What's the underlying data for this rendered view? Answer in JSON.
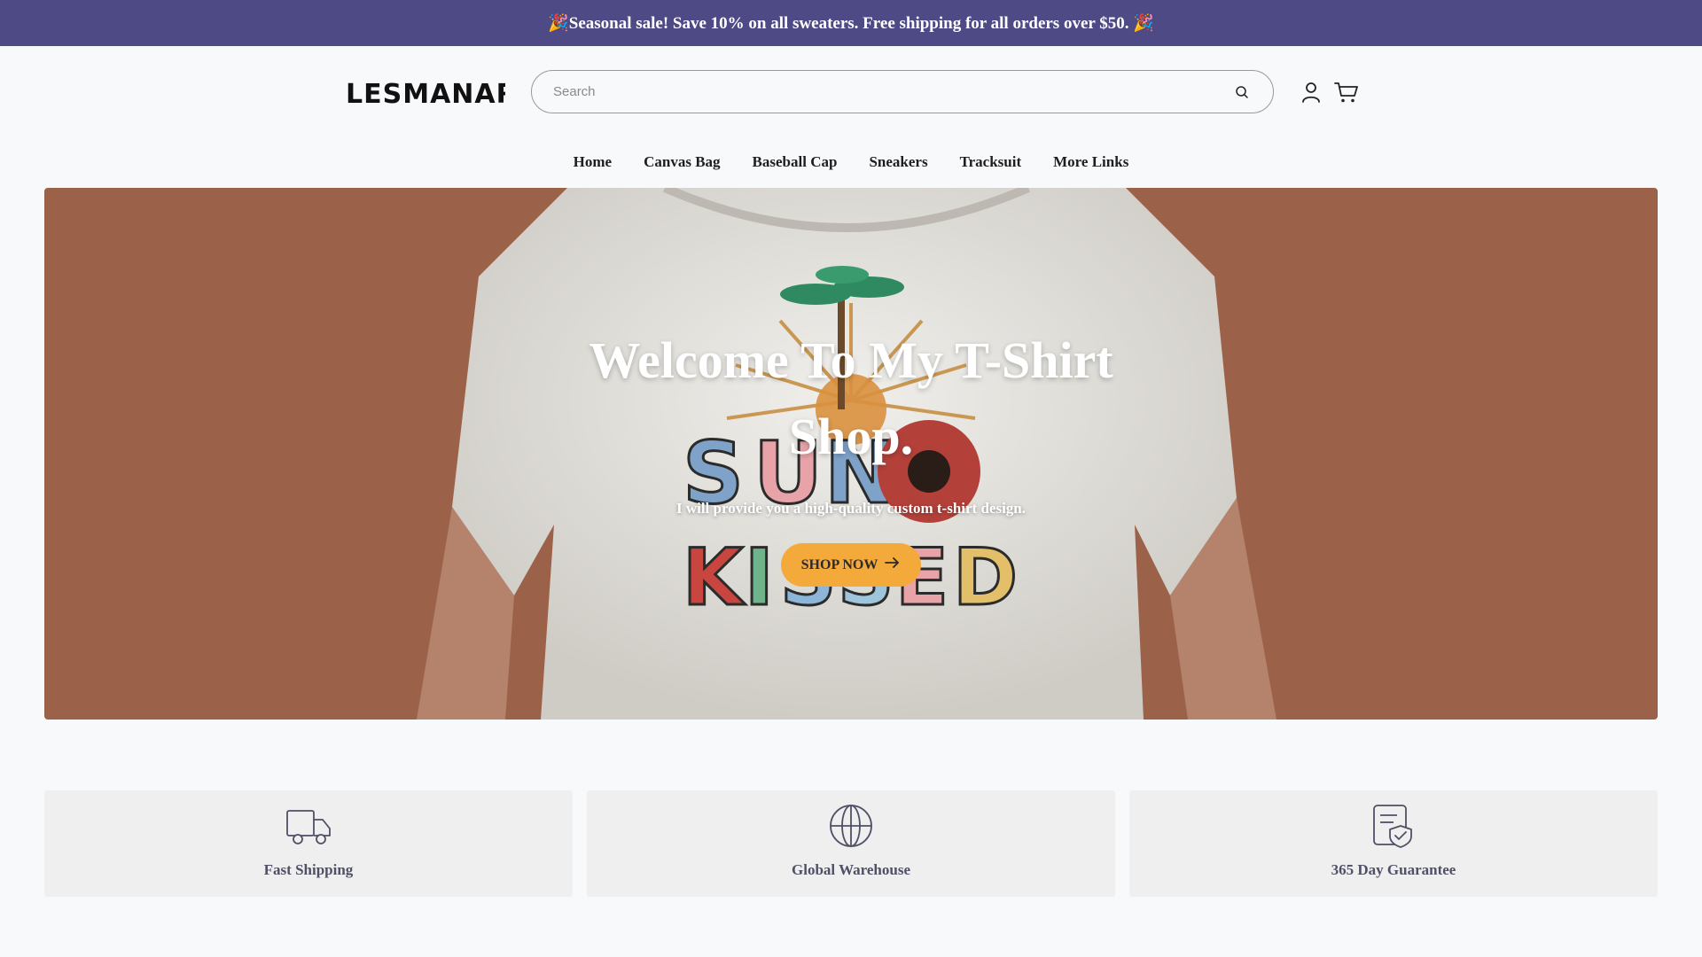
{
  "announcement": {
    "text": "🎉Seasonal sale! Save 10% on all sweaters. Free shipping for all orders over $50. 🎉"
  },
  "header": {
    "logo_text": "LESMANAR",
    "search": {
      "placeholder": "Search",
      "value": "",
      "icon": "search-icon"
    },
    "icons": [
      "account-icon",
      "cart-icon"
    ]
  },
  "nav": {
    "items": [
      {
        "label": "Home"
      },
      {
        "label": "Canvas Bag"
      },
      {
        "label": "Baseball Cap"
      },
      {
        "label": "Sneakers"
      },
      {
        "label": "Tracksuit"
      },
      {
        "label": "More Links"
      }
    ]
  },
  "hero": {
    "title": "Welcome To My T-Shirt Shop.",
    "subtitle": "I will provide you a high-quality custom t-shirt design.",
    "button_label": "SHOP NOW",
    "button_icon": "arrow-right-icon",
    "background_color": "#9c6149",
    "button_color": "#f4a93b"
  },
  "features": [
    {
      "label": "Fast Shipping",
      "icon": "truck-icon"
    },
    {
      "label": "Global Warehouse",
      "icon": "globe-icon"
    },
    {
      "label": "365 Day Guarantee",
      "icon": "guarantee-document-icon"
    }
  ],
  "colors": {
    "announcement_bg": "#4e4a85",
    "feature_text": "#4f5066",
    "page_bg": "#f8f9fb"
  }
}
